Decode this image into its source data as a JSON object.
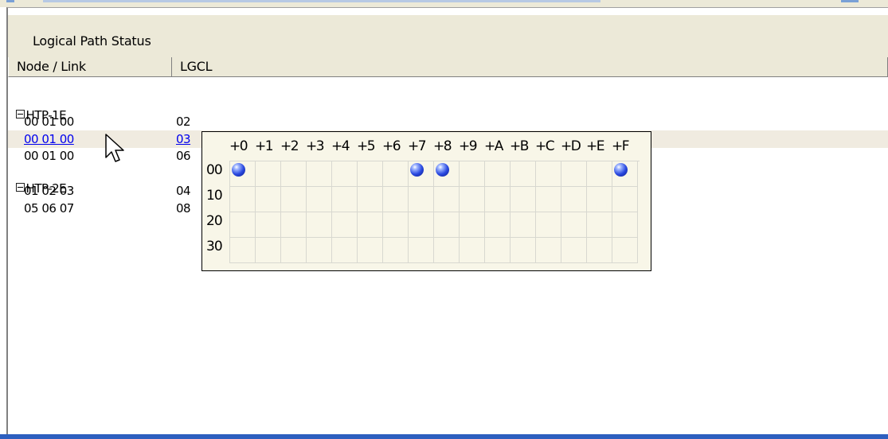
{
  "panel": {
    "title": "Logical Path Status"
  },
  "columns": {
    "node": "Node / Link",
    "lgcl": "LGCL"
  },
  "tree": {
    "groups": [
      {
        "name": "HTP-1E",
        "rows": [
          {
            "link": "00 01 00",
            "lgcl": "02"
          },
          {
            "link": "00 01 00",
            "lgcl": "03",
            "selected": true
          },
          {
            "link": "00 01 00",
            "lgcl": "06"
          }
        ]
      },
      {
        "name": "HTP-2E",
        "rows": [
          {
            "link": "01 02 03",
            "lgcl": "04"
          },
          {
            "link": "05 06 07",
            "lgcl": "08"
          }
        ]
      }
    ]
  },
  "popup": {
    "col_labels": [
      "+0",
      "+1",
      "+2",
      "+3",
      "+4",
      "+5",
      "+6",
      "+7",
      "+8",
      "+9",
      "+A",
      "+B",
      "+C",
      "+D",
      "+E",
      "+F"
    ],
    "row_labels": [
      "00",
      "10",
      "20",
      "30"
    ],
    "active": [
      [
        0,
        0
      ],
      [
        0,
        7
      ],
      [
        0,
        8
      ],
      [
        0,
        15
      ]
    ],
    "marker_icon": "blue-sphere-icon"
  }
}
